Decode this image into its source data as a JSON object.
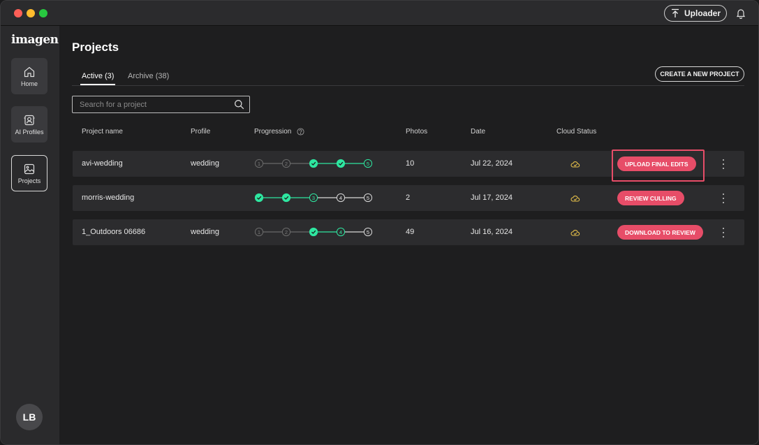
{
  "titlebar": {
    "uploader_label": "Uploader"
  },
  "sidebar": {
    "logo": "imagen",
    "items": [
      {
        "label": "Home",
        "icon": "home-icon"
      },
      {
        "label": "AI Profiles",
        "icon": "ai-profile-icon"
      },
      {
        "label": "Projects",
        "icon": "projects-icon"
      }
    ],
    "avatar_initials": "LB"
  },
  "main": {
    "title": "Projects",
    "tabs": [
      {
        "label": "Active (3)",
        "active": true
      },
      {
        "label": "Archive (38)",
        "active": false
      }
    ],
    "create_label": "CREATE A NEW PROJECT",
    "search_placeholder": "Search for a project",
    "columns": {
      "name": "Project name",
      "profile": "Profile",
      "progression": "Progression",
      "photos": "Photos",
      "date": "Date",
      "cloud": "Cloud Status"
    },
    "rows": [
      {
        "name": "avi-wedding",
        "profile": "wedding",
        "photos": "10",
        "date": "Jul 22, 2024",
        "action": "UPLOAD FINAL EDITS",
        "steps": [
          "done-gray",
          "done-gray",
          "check",
          "check",
          "current"
        ],
        "step_labels": [
          "1",
          "2",
          "",
          "",
          "5"
        ]
      },
      {
        "name": "morris-wedding",
        "profile": "",
        "photos": "2",
        "date": "Jul 17, 2024",
        "action": "REVIEW CULLING",
        "steps": [
          "check",
          "check",
          "current",
          "pending",
          "pending"
        ],
        "step_labels": [
          "",
          "",
          "3",
          "4",
          "5"
        ]
      },
      {
        "name": "1_Outdoors 06686",
        "profile": "wedding",
        "photos": "49",
        "date": "Jul 16, 2024",
        "action": "DOWNLOAD TO REVIEW",
        "steps": [
          "done-gray",
          "done-gray",
          "check",
          "current",
          "pending"
        ],
        "step_labels": [
          "1",
          "2",
          "",
          "4",
          "5"
        ]
      }
    ]
  },
  "colors": {
    "accent": "#e74d68",
    "progress_green": "#2ee6a0",
    "background": "#1e1e1f"
  }
}
